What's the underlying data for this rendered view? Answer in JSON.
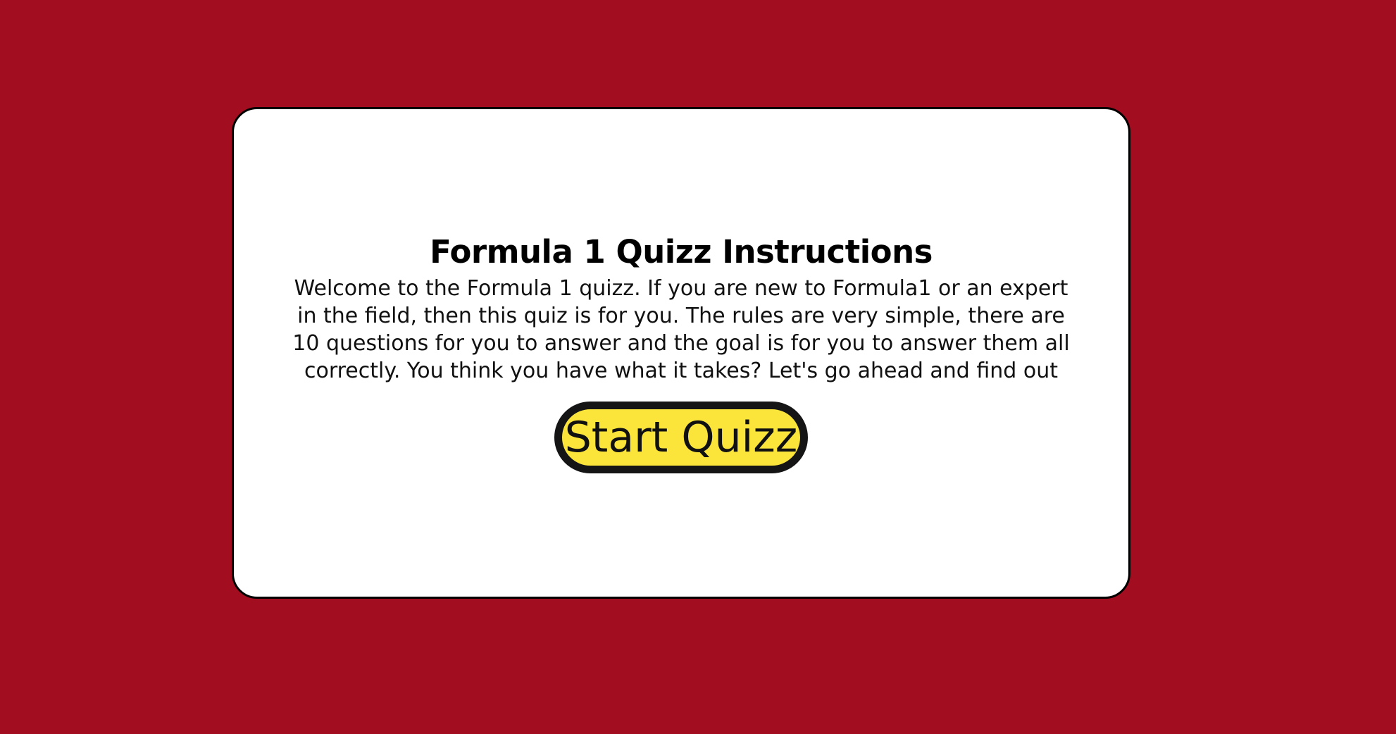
{
  "instructions": {
    "title": "Formula 1 Quizz Instructions",
    "body": "Welcome to the Formula 1 quizz. If you are new to Formula1 or an expert in the field, then this quiz is for you. The rules are very simple, there are 10 questions for you to answer and the goal is for you to answer them all correctly. You think you have what it takes? Let's go ahead and find out",
    "start_label": "Start Quizz"
  },
  "colors": {
    "background": "#a30d20",
    "card": "#ffffff",
    "button": "#fbe53a",
    "button_border": "#151515"
  }
}
